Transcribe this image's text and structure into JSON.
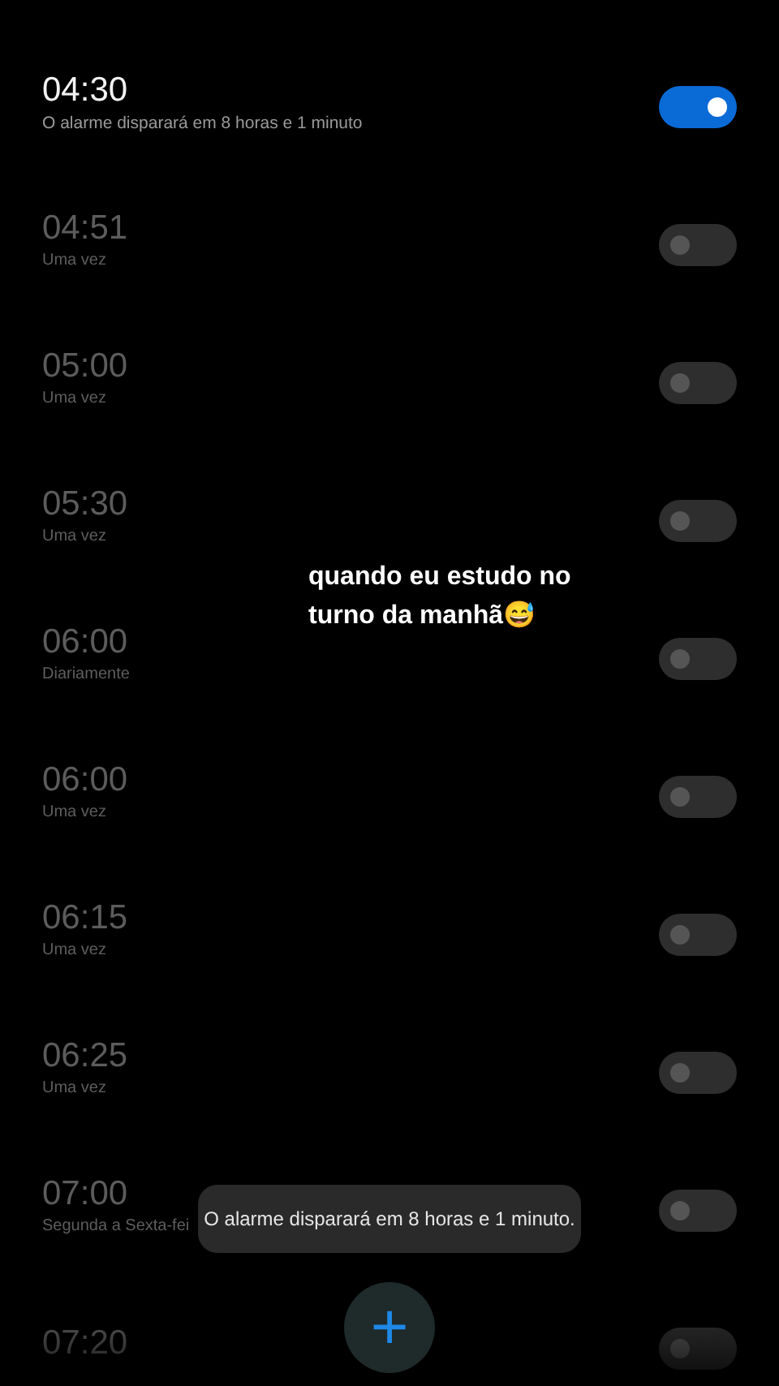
{
  "alarms": [
    {
      "time": "04:30",
      "subtitle": "O alarme disparará em 8 horas e 1 minuto",
      "on": true
    },
    {
      "time": "04:51",
      "subtitle": "Uma vez",
      "on": false
    },
    {
      "time": "05:00",
      "subtitle": "Uma vez",
      "on": false
    },
    {
      "time": "05:30",
      "subtitle": "Uma vez",
      "on": false
    },
    {
      "time": "06:00",
      "subtitle": "Diariamente",
      "on": false
    },
    {
      "time": "06:00",
      "subtitle": "Uma vez",
      "on": false
    },
    {
      "time": "06:15",
      "subtitle": "Uma vez",
      "on": false
    },
    {
      "time": "06:25",
      "subtitle": "Uma vez",
      "on": false
    },
    {
      "time": "07:00",
      "subtitle": "Segunda a Sexta-fei",
      "on": false
    },
    {
      "time": "07:20",
      "on": false
    }
  ],
  "caption": "quando eu estudo no turno da manhã😅",
  "toast": "O alarme disparará em 8 horas e 1 minuto.",
  "add_button": "+"
}
